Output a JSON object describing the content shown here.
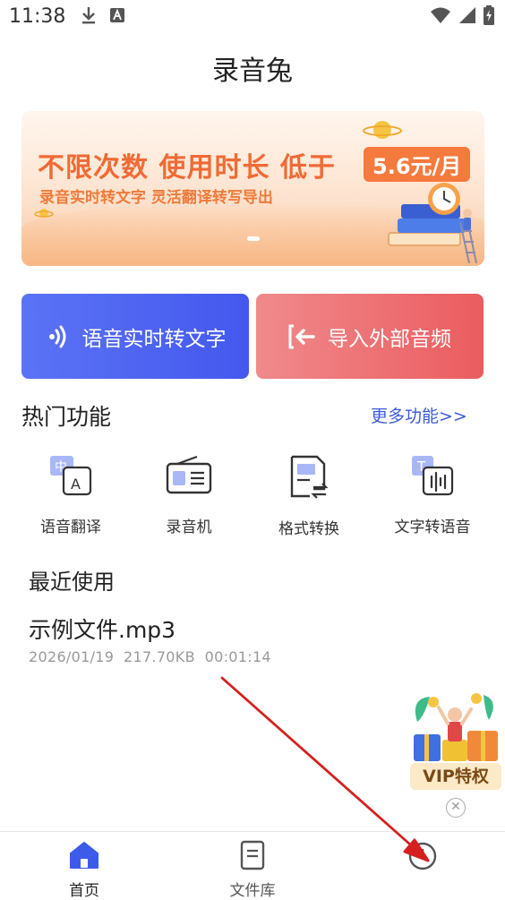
{
  "status_bar": {
    "time": "11:38"
  },
  "app": {
    "title": "录音兔"
  },
  "banner": {
    "headline": "不限次数 使用时长 低于",
    "price": "5.6元/月",
    "subline": "录音实时转文字 灵活翻译转写导出"
  },
  "actions": [
    {
      "label": "语音实时转文字",
      "color": "#4e63f2"
    },
    {
      "label": "导入外部音频",
      "color": "#ec6e70"
    }
  ],
  "hot_section": {
    "title": "热门功能",
    "more": "更多功能>>"
  },
  "features": [
    {
      "label": "语音翻译",
      "icon": "translate-icon"
    },
    {
      "label": "录音机",
      "icon": "radio-icon"
    },
    {
      "label": "格式转换",
      "icon": "format-convert-icon"
    },
    {
      "label": "文字转语音",
      "icon": "text-to-speech-icon"
    }
  ],
  "recent": {
    "title": "最近使用",
    "files": [
      {
        "name": "示例文件.mp3",
        "date": "2026/01/19",
        "size": "217.70KB",
        "duration": "00:01:14"
      }
    ]
  },
  "vip": {
    "label": "VIP特权"
  },
  "nav": {
    "items": [
      {
        "label": "首页",
        "icon": "home-icon",
        "active": true
      },
      {
        "label": "文件库",
        "icon": "document-icon",
        "active": false
      },
      {
        "label": "",
        "icon": "profile-icon",
        "active": false
      }
    ]
  },
  "colors": {
    "accent": "#3b5bd9",
    "annotation_arrow": "#d42020"
  }
}
